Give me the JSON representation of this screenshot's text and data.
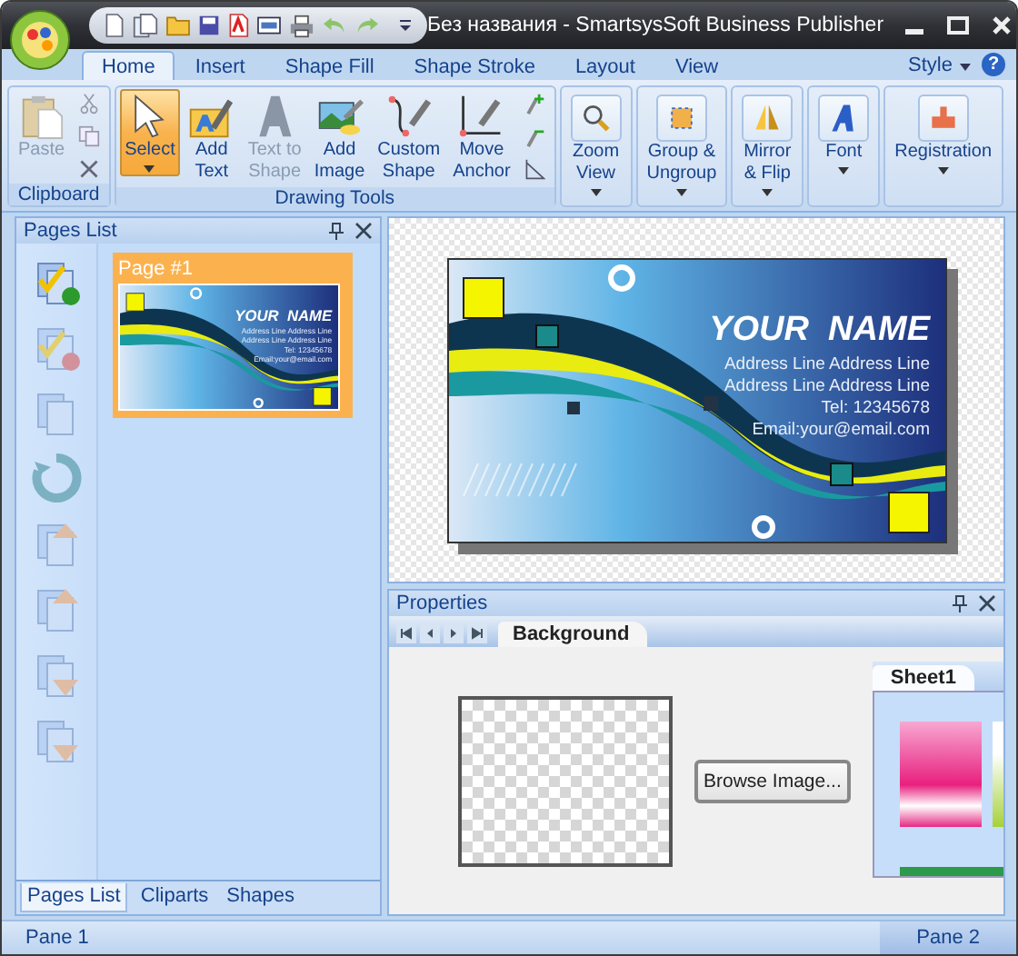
{
  "window": {
    "title": "Без названия - SmartsysSoft Business Publisher"
  },
  "ribbon": {
    "tabs": [
      {
        "label": "Home",
        "selected": true
      },
      {
        "label": "Insert",
        "selected": false
      },
      {
        "label": "Shape Fill",
        "selected": false
      },
      {
        "label": "Shape Stroke",
        "selected": false
      },
      {
        "label": "Layout",
        "selected": false
      },
      {
        "label": "View",
        "selected": false
      }
    ],
    "style_menu": "Style",
    "help": "?",
    "groups": [
      {
        "label": "Clipboard",
        "buttons": [
          {
            "kind": "paste",
            "label": "Paste",
            "disabled": true,
            "selected": false,
            "dropdown": false
          }
        ]
      },
      {
        "label": "Drawing Tools",
        "buttons": [
          {
            "kind": "select",
            "label": "Select",
            "disabled": false,
            "selected": true,
            "dropdown": true
          },
          {
            "kind": "text",
            "label": "Add\nText",
            "disabled": false,
            "selected": false,
            "dropdown": false
          },
          {
            "kind": "texttoshape",
            "label": "Text to\nShape",
            "disabled": true,
            "selected": false,
            "dropdown": false
          },
          {
            "kind": "image",
            "label": "Add\nImage",
            "disabled": false,
            "selected": false,
            "dropdown": false
          },
          {
            "kind": "curve",
            "label": "Custom\nShape",
            "disabled": false,
            "selected": false,
            "dropdown": false
          },
          {
            "kind": "anchor",
            "label": "Move\nAnchor",
            "disabled": false,
            "selected": false,
            "dropdown": false
          }
        ]
      },
      {
        "buttons": [
          {
            "kind": "zoom",
            "label": "Zoom\nView",
            "disabled": false,
            "selected": false,
            "dropdown": true
          }
        ]
      },
      {
        "buttons": [
          {
            "kind": "group",
            "label": "Group &\nUngroup",
            "disabled": false,
            "selected": false,
            "dropdown": true
          }
        ]
      },
      {
        "buttons": [
          {
            "kind": "mirror",
            "label": "Mirror\n& Flip",
            "disabled": false,
            "selected": false,
            "dropdown": true
          }
        ]
      },
      {
        "buttons": [
          {
            "kind": "font",
            "label": "Font",
            "disabled": false,
            "selected": false,
            "dropdown": true
          }
        ]
      },
      {
        "buttons": [
          {
            "kind": "register",
            "label": "Registration",
            "disabled": false,
            "selected": false,
            "dropdown": true
          }
        ]
      }
    ]
  },
  "pages_panel": {
    "title": "Pages List",
    "pages": [
      {
        "label": "Page #1",
        "selected": true,
        "card": {
          "name": "YOUR  NAME",
          "lines": [
            "Address Line Address Line",
            "Address Line Address Line",
            "Tel:  12345678",
            "Email:your@email.com"
          ]
        }
      }
    ],
    "tabs": [
      {
        "label": "Pages List",
        "selected": true
      },
      {
        "label": "Cliparts",
        "selected": false
      },
      {
        "label": "Shapes",
        "selected": false
      }
    ]
  },
  "canvas": {
    "card": {
      "name": "YOUR  NAME",
      "lines": [
        "Address Line Address Line",
        "Address Line Address Line",
        "Tel:  12345678",
        "Email:your@email.com"
      ]
    }
  },
  "properties": {
    "title": "Properties",
    "tabs": [
      {
        "label": "Background",
        "selected": true
      }
    ],
    "browse_button": "Browse Image...",
    "sheet_tabs": [
      {
        "label": "Sheet1",
        "selected": true
      }
    ]
  },
  "status_bar": {
    "left": "Pane 1",
    "right": "Pane 2"
  }
}
